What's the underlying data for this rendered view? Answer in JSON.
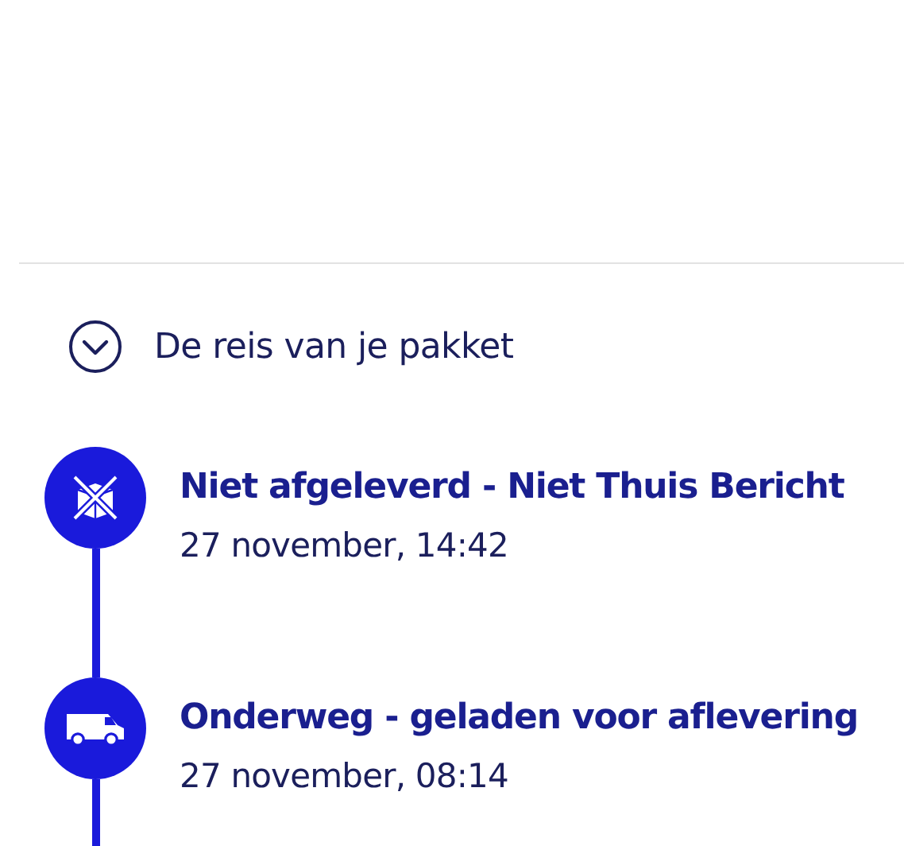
{
  "section": {
    "title": "De reis van je pakket",
    "expanded": true
  },
  "events": [
    {
      "kind": "not-delivered",
      "title": "Niet afgeleverd - Niet Thuis Bericht",
      "date": "27 november, 14:42"
    },
    {
      "kind": "van",
      "title": "Onderweg - geladen voor aflevering",
      "date": "27 november, 08:14"
    }
  ]
}
